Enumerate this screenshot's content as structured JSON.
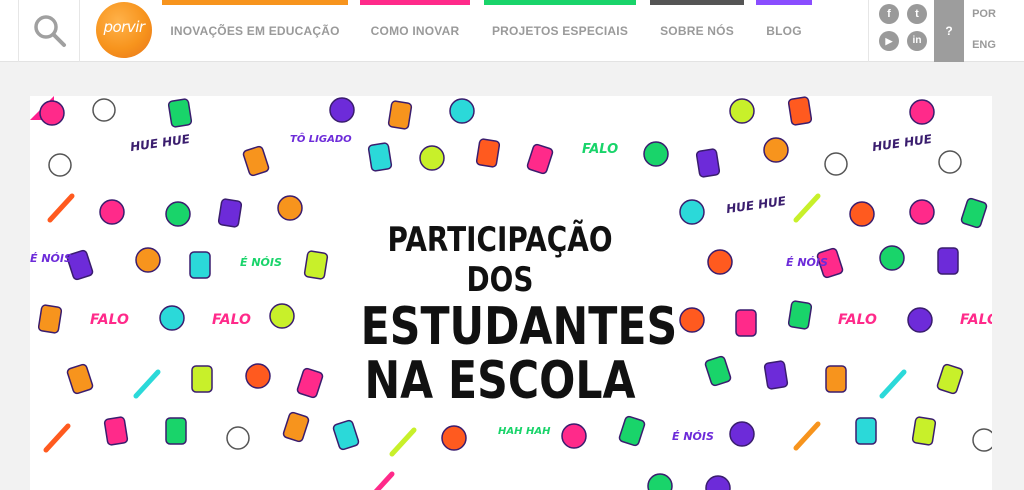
{
  "logo": {
    "text": "porvir",
    "color": "#f7941d"
  },
  "nav": [
    {
      "label": "INOVAÇÕES EM EDUCAÇÃO",
      "color": "#f7941d"
    },
    {
      "label": "COMO INOVAR",
      "color": "#ff2a8a"
    },
    {
      "label": "PROJETOS ESPECIAIS",
      "color": "#19d46a"
    },
    {
      "label": "SOBRE NÓS",
      "color": "#555555"
    },
    {
      "label": "BLOG",
      "color": "#8a4dff"
    }
  ],
  "social": {
    "facebook": "f",
    "twitter": "t",
    "youtube": "▶",
    "linkedin": "in"
  },
  "help": "?",
  "languages": [
    "POR",
    "ENG"
  ],
  "banner": {
    "headline_line1": "PARTICIPAÇÃO DOS",
    "headline_line2": "ESTUDANTES",
    "headline_line3": "NA ESCOLA",
    "stickers": {
      "huehue": "HUE HUE",
      "falo": "FALO",
      "enois": "É NÓIS",
      "toligado": "TÔ LIGADO",
      "hahaha": "HAH HAH"
    }
  }
}
